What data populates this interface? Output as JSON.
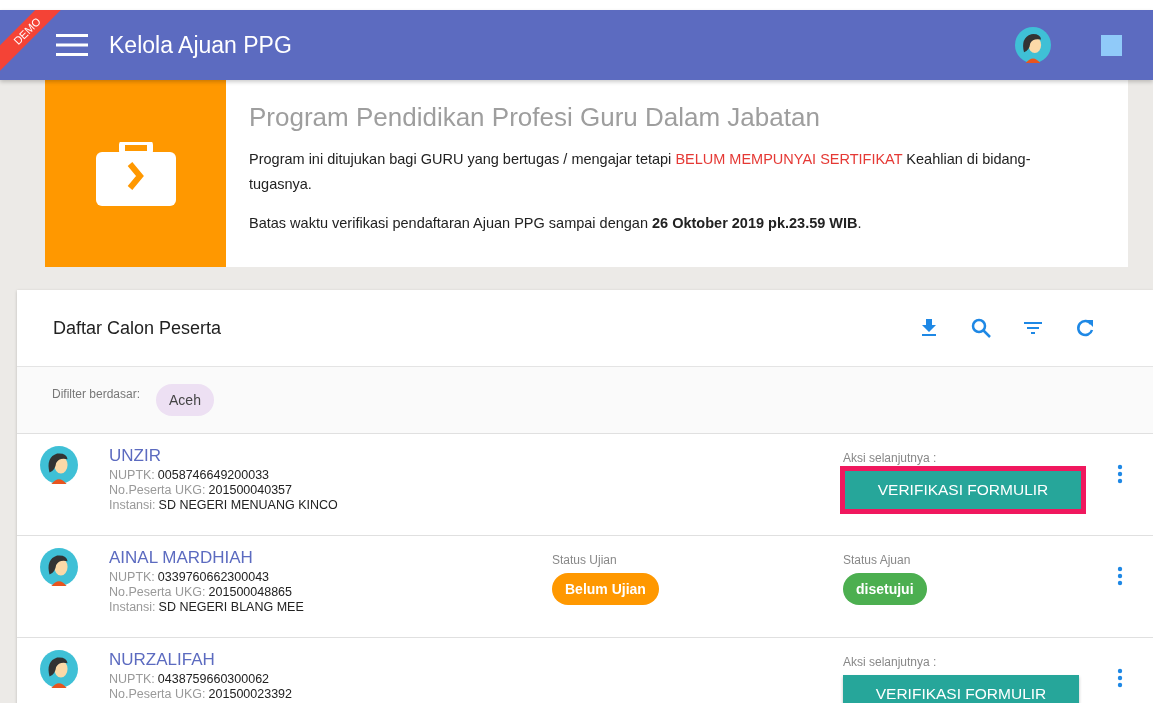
{
  "ribbon": "DEMO",
  "header": {
    "title": "Kelola Ajuan PPG"
  },
  "banner": {
    "title": "Program Pendidikan Profesi Guru Dalam Jabatan",
    "paragraphs": [
      [
        {
          "kind": "plain",
          "text": "Program ini ditujukan bagi GURU yang bertugas / mengajar tetapi "
        },
        {
          "kind": "alert",
          "text": "BELUM MEMPUNYAI SERTIFIKAT"
        },
        {
          "kind": "plain",
          "text": " Keahlian di bidang-tugasnya."
        }
      ],
      [
        {
          "kind": "plain",
          "text": "Batas waktu verifikasi pendaftaran Ajuan PPG sampai dengan **26 Oktober 2019 pk.23.59 WIB**."
        }
      ]
    ]
  },
  "list": {
    "title": "Daftar Calon Peserta",
    "filter_label": "Difilter berdasar:",
    "filters": [
      "Aceh"
    ],
    "rows": [
      {
        "name": "UNZIR",
        "fields": [
          {
            "label": "NUPTK:",
            "value": "0058746649200033"
          },
          {
            "label": "No.Peserta UKG:",
            "value": "201500040357"
          },
          {
            "label": "Instansi:",
            "value": "SD NEGERI MENUANG KINCO"
          }
        ],
        "kind": "action",
        "action_label": "Aksi selanjutnya :",
        "action": "VERIFIKASI FORMULIR",
        "highlighted": true
      },
      {
        "name": "AINAL MARDHIAH",
        "fields": [
          {
            "label": "NUPTK:",
            "value": "0339760662300043"
          },
          {
            "label": "No.Peserta UKG:",
            "value": "201500048865"
          },
          {
            "label": "Instansi:",
            "value": "SD NEGERI BLANG MEE"
          }
        ],
        "kind": "status",
        "statuses": [
          {
            "label": "Status Ujian",
            "value": "Belum Ujian",
            "color": "#ff9800"
          },
          {
            "label": "Status Ajuan",
            "value": "disetujui",
            "color": "#4caf50"
          }
        ]
      },
      {
        "name": "NURZALIFAH",
        "fields": [
          {
            "label": "NUPTK:",
            "value": "0438759660300062"
          },
          {
            "label": "No.Peserta UKG:",
            "value": "201500023392"
          }
        ],
        "kind": "action",
        "action_label": "Aksi selanjutnya :",
        "action": "VERIFIKASI FORMULIR",
        "highlighted": false
      }
    ]
  }
}
